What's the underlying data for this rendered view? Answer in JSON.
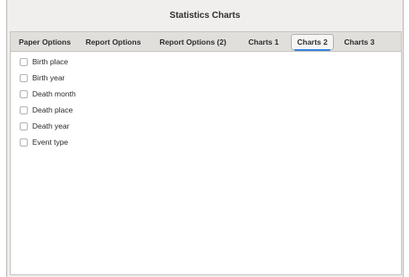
{
  "window": {
    "title": "Statistics Charts"
  },
  "tabs": [
    {
      "label": "Paper Options"
    },
    {
      "label": "Report Options"
    },
    {
      "label": "Report Options (2)"
    },
    {
      "label": "Charts 1"
    },
    {
      "label": "Charts 2"
    },
    {
      "label": "Charts 3"
    }
  ],
  "active_tab": "Charts 2",
  "checkboxes": [
    {
      "label": "Birth place",
      "checked": false
    },
    {
      "label": "Birth year",
      "checked": false
    },
    {
      "label": "Death month",
      "checked": false
    },
    {
      "label": "Death place",
      "checked": false
    },
    {
      "label": "Death year",
      "checked": false
    },
    {
      "label": "Event type",
      "checked": false
    }
  ],
  "colors": {
    "accent": "#3584e4",
    "tabbar": "#e1dfdc",
    "page": "#ffffff"
  }
}
